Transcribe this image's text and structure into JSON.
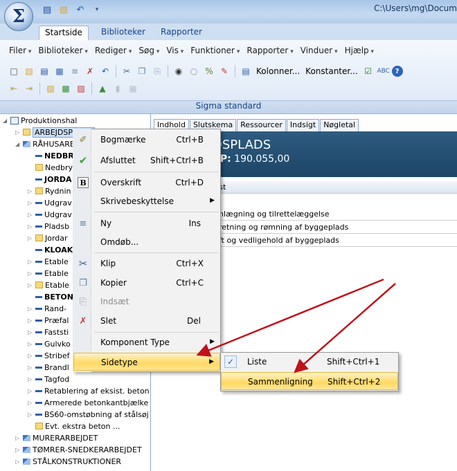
{
  "titlebar": {
    "path": "C:\\Users\\mg\\Docume"
  },
  "ribbon": {
    "tabs": [
      "Startside",
      "Biblioteker",
      "Rapporter"
    ],
    "menus": [
      "Filer",
      "Biblioteker",
      "Rediger",
      "Søg",
      "Vis",
      "Funktioner",
      "Rapporter",
      "Vinduer",
      "Hjælp"
    ],
    "toolbar": {
      "columns_label": "Kolonner...",
      "constants_label": "Konstanter..."
    },
    "group_label": "Sigma standard"
  },
  "tree": {
    "root": "Produktionshal",
    "items": [
      {
        "label": "ARBEJDSPLADS"
      },
      {
        "label": "RÅHUSARBEJDET"
      },
      {
        "label": "NEDBR"
      },
      {
        "label": "Nedbry"
      },
      {
        "label": "JORDA"
      },
      {
        "label": "Rydnin"
      },
      {
        "label": "Udgrav"
      },
      {
        "label": "Udgrav"
      },
      {
        "label": "Pladsb"
      },
      {
        "label": "Jordar"
      },
      {
        "label": "KLOAK"
      },
      {
        "label": "Etable"
      },
      {
        "label": "Etable"
      },
      {
        "label": "Etable"
      },
      {
        "label": "BETON"
      },
      {
        "label": "Rand-"
      },
      {
        "label": "Præfal"
      },
      {
        "label": "Faststi"
      },
      {
        "label": "Gulvko"
      },
      {
        "label": "Stribef"
      },
      {
        "label": "Brandl"
      },
      {
        "label": "Tagfod"
      },
      {
        "label": "Retablering af eksist. beton"
      },
      {
        "label": "Armerede betonkantbjælke"
      },
      {
        "label": "BS60-omstøbning af stålsøj"
      },
      {
        "label": "Evt. ekstra beton ..."
      },
      {
        "label": "MURERARBEJDET"
      },
      {
        "label": "TØMRER-SNEDKERARBEJDET"
      },
      {
        "label": "STÅLKONSTRUKTIONER"
      }
    ]
  },
  "doc": {
    "tabs": [
      "Indhold",
      "Slutskema",
      "Ressourcer",
      "Indsigt",
      "Nøgletal"
    ],
    "title": "DSPLADS",
    "kp_label": "KP:",
    "kp_value": "190.055,00",
    "column_header": "kst",
    "rows": [
      "nlægning og tilrettelæggelse",
      "retning og rømning af byggeplads",
      "ft og vedligehold af byggeplads"
    ]
  },
  "context_menu": {
    "items": [
      {
        "label": "Bogmærke",
        "shortcut": "Ctrl+B",
        "icon": "bookmark-icon"
      },
      {
        "label": "Afsluttet",
        "shortcut": "Shift+Ctrl+B",
        "icon": "checkmark-icon"
      },
      {
        "label": "Overskrift",
        "shortcut": "Ctrl+D",
        "icon": "bold-b-icon"
      },
      {
        "label": "Skrivebeskyttelse",
        "shortcut": ""
      },
      {
        "label": "Ny",
        "shortcut": "Ins",
        "icon": "new-line-icon"
      },
      {
        "label": "Omdøb...",
        "shortcut": ""
      },
      {
        "label": "Klip",
        "shortcut": "Ctrl+X",
        "icon": "scissors-icon"
      },
      {
        "label": "Kopier",
        "shortcut": "Ctrl+C",
        "icon": "copy-icon"
      },
      {
        "label": "Indsæt",
        "shortcut": "",
        "icon": "paste-icon"
      },
      {
        "label": "Slet",
        "shortcut": "Del",
        "icon": "delete-icon"
      },
      {
        "label": "Komponent Type",
        "shortcut": ""
      },
      {
        "label": "Sidetype",
        "shortcut": ""
      }
    ]
  },
  "sub_menu": {
    "items": [
      {
        "label": "Liste",
        "shortcut": "Shift+Ctrl+1"
      },
      {
        "label": "Sammenligning",
        "shortcut": "Shift+Ctrl+2"
      }
    ]
  },
  "colors": {
    "highlight": "#ffd862",
    "header_bg": "#2e5b80",
    "annotation_arrow": "#c0121b"
  }
}
